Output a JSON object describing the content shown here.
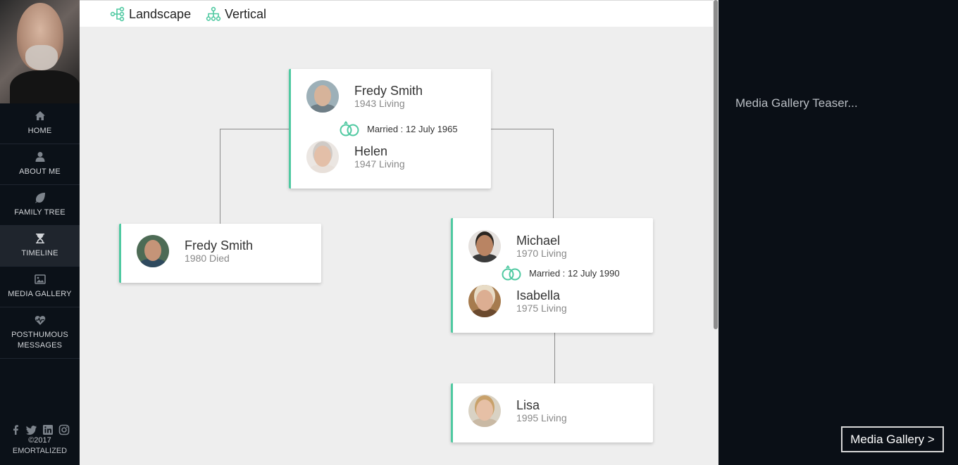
{
  "sidebar": {
    "nav": [
      {
        "label": "HOME",
        "icon": "home-icon"
      },
      {
        "label": "ABOUT ME",
        "icon": "user-icon"
      },
      {
        "label": "FAMILY TREE",
        "icon": "leaf-icon"
      },
      {
        "label": "TIMELINE",
        "icon": "hourglass-icon"
      },
      {
        "label": "MEDIA GALLERY",
        "icon": "image-icon"
      },
      {
        "label": "POSTHUMOUS\nMESSAGES",
        "icon": "heartbeat-icon"
      }
    ],
    "active_index": 3,
    "social": [
      "facebook-icon",
      "twitter-icon",
      "linkedin-icon",
      "instagram-icon"
    ],
    "copyright_year": "©2017",
    "copyright_name": "EMORTALIZED"
  },
  "view_bar": {
    "landscape_label": "Landscape",
    "vertical_label": "Vertical"
  },
  "tree": {
    "couple1": {
      "person1": {
        "name": "Fredy Smith",
        "info": "1943 Living"
      },
      "marriage": "Married : 12 July 1965",
      "person2": {
        "name": "Helen",
        "info": "1947 Living"
      }
    },
    "child1": {
      "name": "Fredy Smith",
      "info": "1980 Died"
    },
    "couple2": {
      "person1": {
        "name": "Michael",
        "info": "1970 Living"
      },
      "marriage": "Married : 12 July 1990",
      "person2": {
        "name": "Isabella",
        "info": "1975 Living"
      }
    },
    "grandchild": {
      "name": "Lisa",
      "info": "1995 Living"
    }
  },
  "right_panel": {
    "teaser": "Media Gallery Teaser...",
    "button": "Media Gallery >"
  },
  "colors": {
    "accent": "#4fc9a1",
    "sidebar_bg": "#0b1118",
    "canvas_bg": "#eeeeee"
  }
}
